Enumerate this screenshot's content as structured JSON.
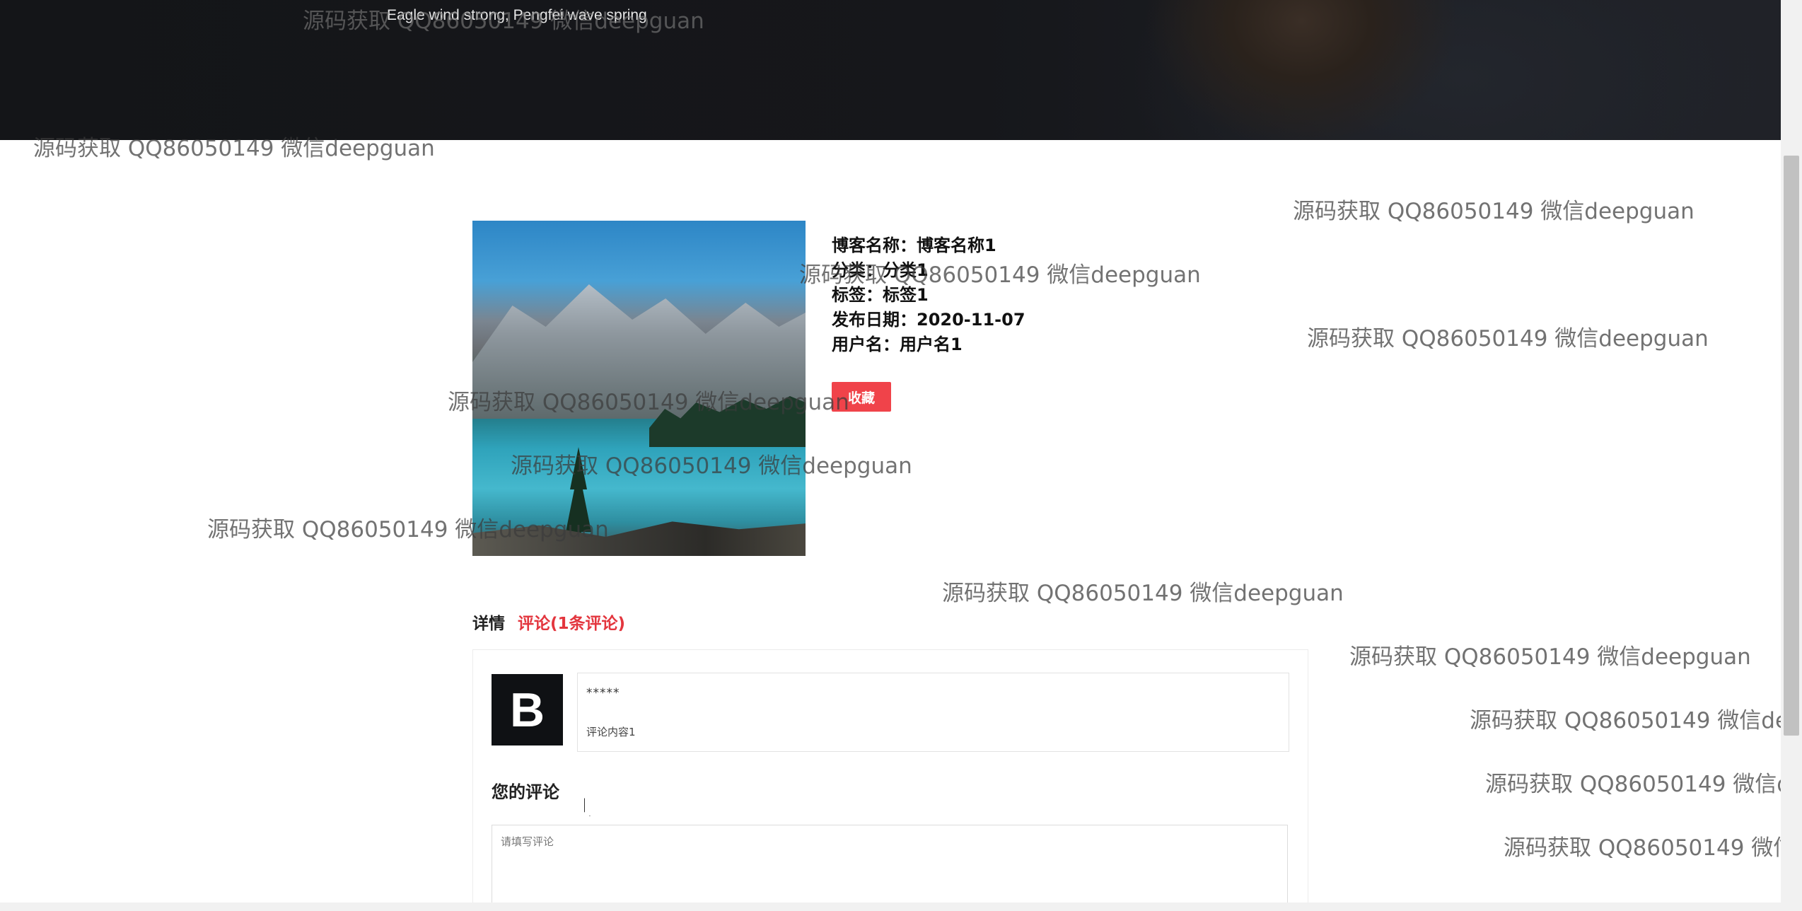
{
  "header": {
    "tagline": "Eagle wind strong, Pengfei wave spring"
  },
  "blog": {
    "name_row": "博客名称：博客名称1",
    "category_row": "分类：分类1",
    "tag_row": "标签：标签1",
    "date_row": "发布日期：2020-11-07",
    "user_row": "用户名：用户名1",
    "favorite_label": "收藏"
  },
  "tabs": [
    {
      "label": "详情",
      "active": false
    },
    {
      "label": "评论(1条评论)",
      "active": true
    }
  ],
  "comments": [
    {
      "avatar_letter": "B",
      "user": "*****",
      "content": "评论内容1"
    }
  ],
  "comment_form": {
    "title": "您的评论",
    "placeholder": "请填写评论"
  },
  "watermark": {
    "text": "源码获取 QQ86050149 微信deepguan"
  },
  "colors": {
    "accent": "#f0434a",
    "active_tab": "#e3363e",
    "banner": "#141518"
  }
}
